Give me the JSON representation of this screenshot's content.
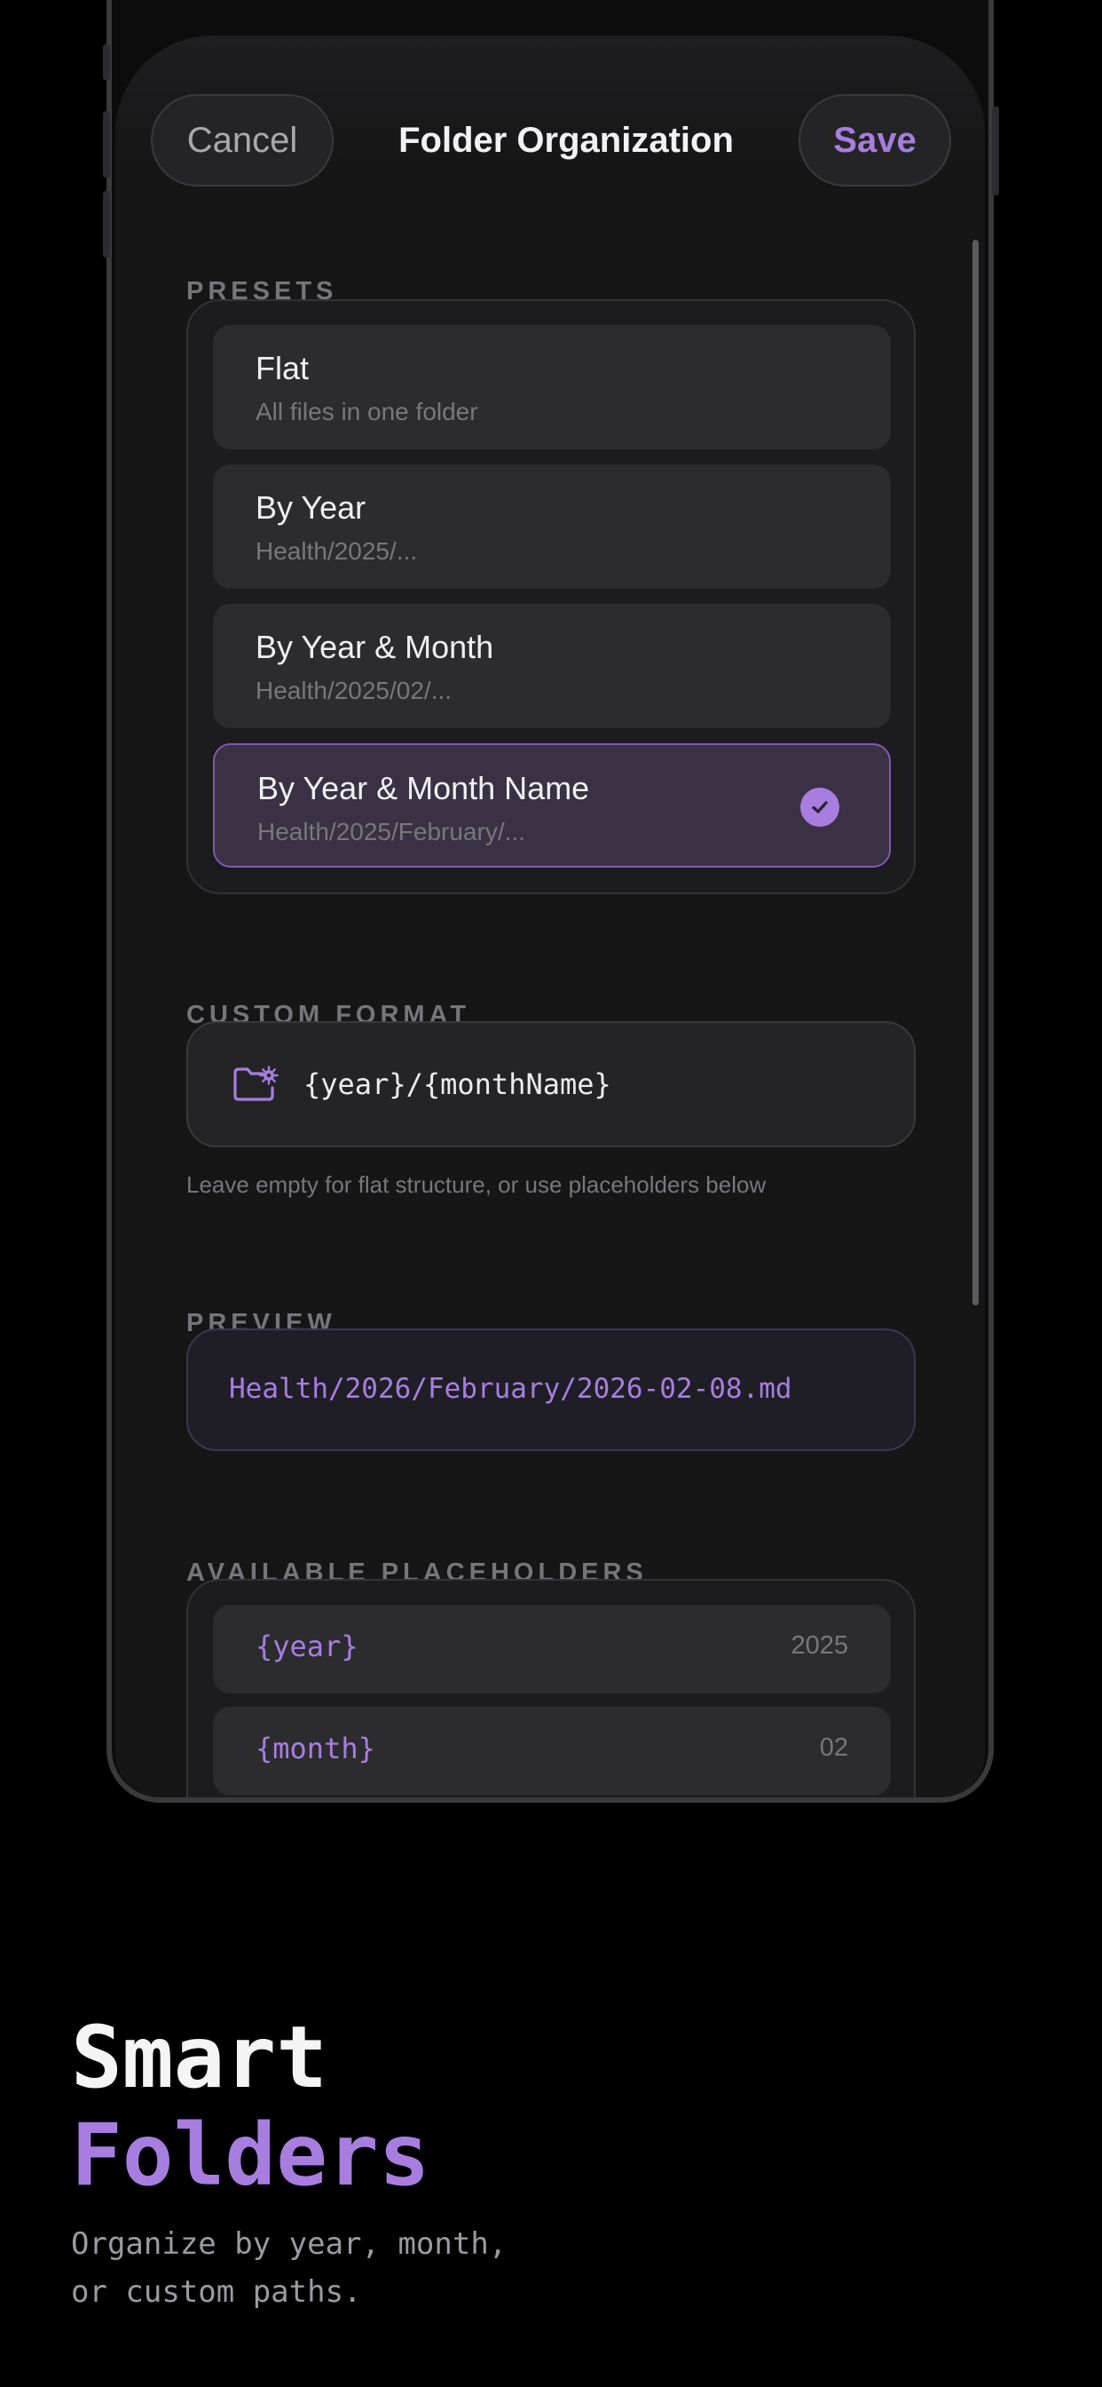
{
  "header": {
    "cancel_label": "Cancel",
    "title": "Folder Organization",
    "save_label": "Save"
  },
  "presets": {
    "section_label": "PRESETS",
    "selected_index": 3,
    "items": [
      {
        "title": "Flat",
        "subtitle": "All files in one folder"
      },
      {
        "title": "By Year",
        "subtitle": "Health/2025/..."
      },
      {
        "title": "By Year & Month",
        "subtitle": "Health/2025/02/..."
      },
      {
        "title": "By Year & Month Name",
        "subtitle": "Health/2025/February/..."
      }
    ]
  },
  "custom_format": {
    "section_label": "CUSTOM FORMAT",
    "icon": "folder-gear-icon",
    "value": "{year}/{monthName}",
    "helper_text": "Leave empty for flat structure, or use placeholders below"
  },
  "preview": {
    "section_label": "PREVIEW",
    "path": "Health/2026/February/2026-02-08.md"
  },
  "placeholders": {
    "section_label": "AVAILABLE PLACEHOLDERS",
    "items": [
      {
        "token": "{year}",
        "example": "2025"
      },
      {
        "token": "{month}",
        "example": "02"
      }
    ]
  },
  "marketing": {
    "headline_line1": "Smart",
    "headline_line2": "Folders",
    "subtitle": "Organize by year, month,\nor custom paths."
  },
  "colors": {
    "accent": "#a77ee0",
    "background": "#000000",
    "surface": "#1c1c1e",
    "row": "#2c2c2e"
  }
}
